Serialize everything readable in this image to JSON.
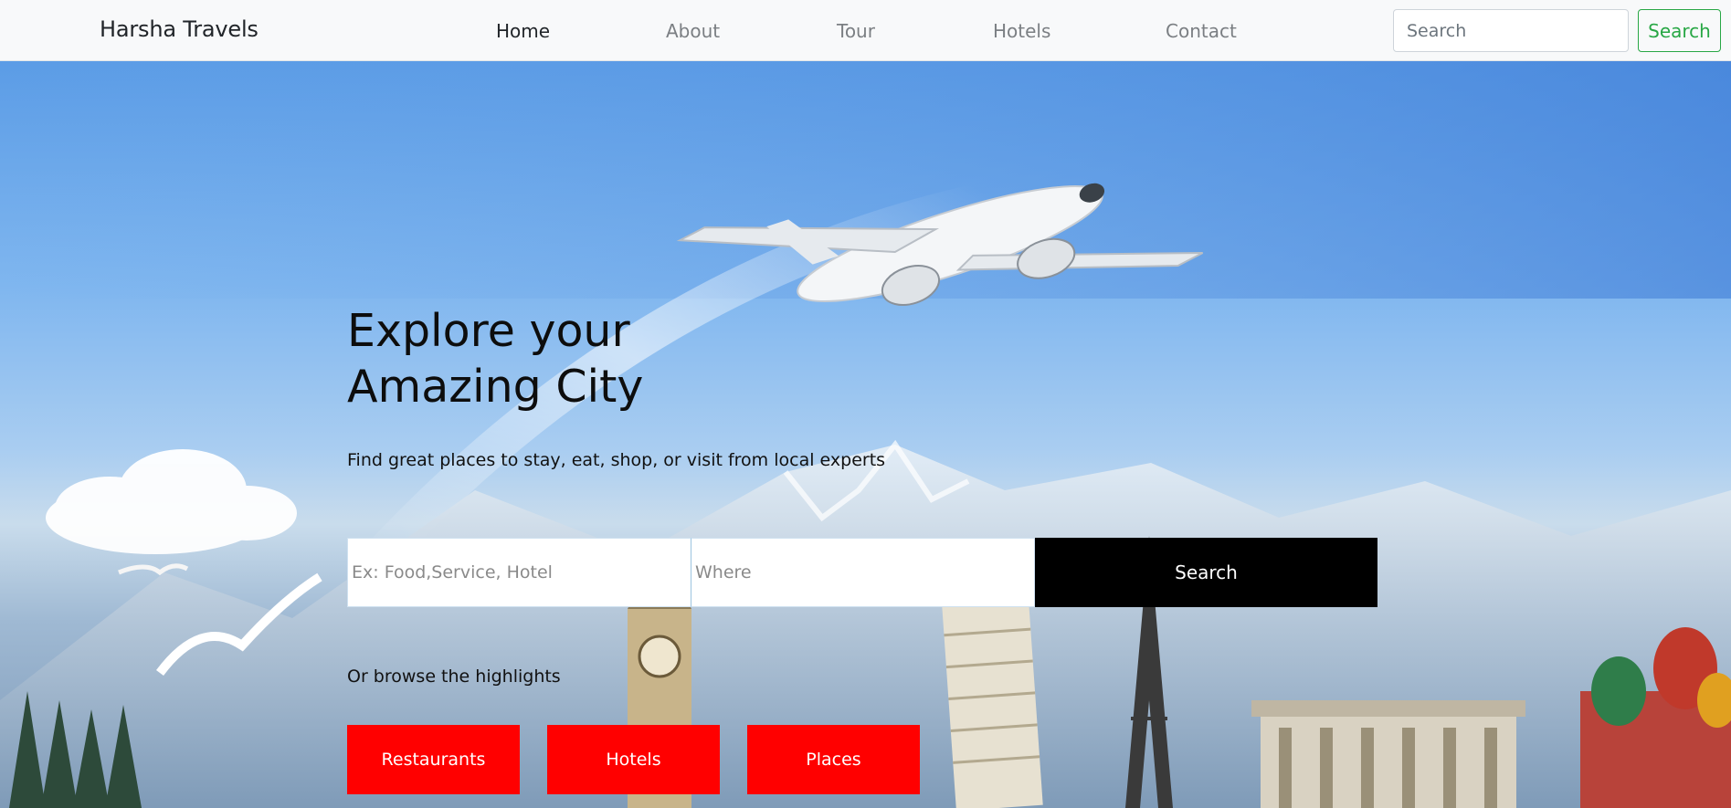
{
  "navbar": {
    "brand": "Harsha Travels",
    "links": [
      {
        "label": "Home",
        "active": true
      },
      {
        "label": "About",
        "active": false
      },
      {
        "label": "Tour",
        "active": false
      },
      {
        "label": "Hotels",
        "active": false
      },
      {
        "label": "Contact",
        "active": false
      }
    ],
    "search_placeholder": "Search",
    "search_button": "Search",
    "accent_color": "#28a745"
  },
  "hero": {
    "title_line1": "Explore your",
    "title_line2": "Amazing City",
    "subtitle": "Find great places to stay, eat, shop, or visit from local experts",
    "what_placeholder": "Ex: Food,Service, Hotel",
    "where_placeholder": "Where",
    "search_button": "Search",
    "browse_text": "Or browse the highlights",
    "categories": [
      "Restaurants",
      "Hotels",
      "Places"
    ],
    "category_color": "#ff0000",
    "background_image": "airplane-over-world-landmarks"
  }
}
